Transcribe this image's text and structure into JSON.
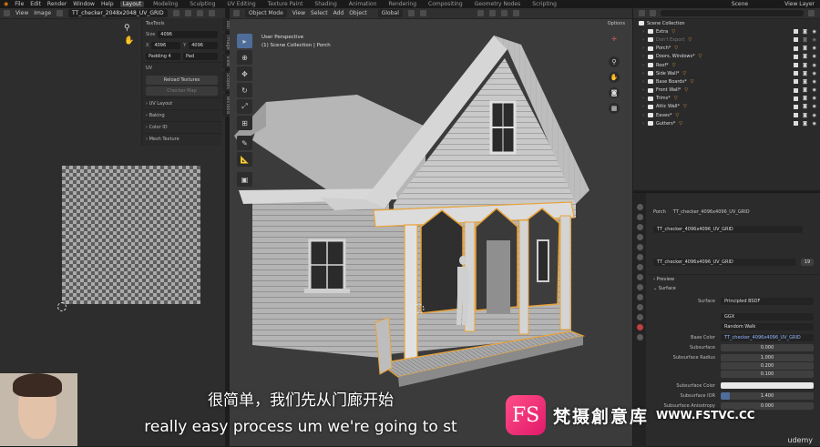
{
  "menu": [
    "File",
    "Edit",
    "Render",
    "Window",
    "Help"
  ],
  "workspaces": [
    "Layout",
    "Modeling",
    "Sculpting",
    "UV Editing",
    "Texture Paint",
    "Shading",
    "Animation",
    "Rendering",
    "Compositing",
    "Geometry Nodes",
    "Scripting"
  ],
  "active_workspace": "Layout",
  "topbar_right": {
    "scene": "Scene",
    "view_layer": "View Layer"
  },
  "uv_editor": {
    "view": "View",
    "image": "Image",
    "image_name": "TT_checker_2048x2048_UV_GRID",
    "npanel": {
      "header": "TexTools",
      "size_label": "Size",
      "size_value": "4096",
      "x_label": "X",
      "x_value": "4096",
      "y_label": "Y",
      "y_value": "4096",
      "padding_label": "Padding",
      "padding_value": "4",
      "pad_right": "Pad",
      "uv_section": "UV",
      "reload_textures": "Reload Textures",
      "checker_map": "Checker Map",
      "sections": [
        "UV Layout",
        "Baking",
        "Color ID",
        "Mesh Texture"
      ]
    },
    "side_tabs": [
      "Tool",
      "Image",
      "View",
      "Scopes",
      "TexTools"
    ]
  },
  "viewport": {
    "mode": "Object Mode",
    "menus": [
      "View",
      "Select",
      "Add",
      "Object"
    ],
    "orientation": "Global",
    "options": "Options",
    "info_line1": "User Perspective",
    "info_line2": "(1) Scene Collection | Porch"
  },
  "outliner": {
    "header": "Scene Collection",
    "items": [
      {
        "name": "Extra",
        "dim": false
      },
      {
        "name": "Don't Export",
        "dim": true
      },
      {
        "name": "Porch*",
        "dim": false
      },
      {
        "name": "Doors, Windows*",
        "dim": false
      },
      {
        "name": "Roof*",
        "dim": false
      },
      {
        "name": "Side Wall*",
        "dim": false
      },
      {
        "name": "Base Boards*",
        "dim": false
      },
      {
        "name": "Front Wall*",
        "dim": false
      },
      {
        "name": "Trims*",
        "dim": false
      },
      {
        "name": "Attic Wall*",
        "dim": false
      },
      {
        "name": "Eaves*",
        "dim": false
      },
      {
        "name": "Gutters*",
        "dim": false
      }
    ]
  },
  "properties": {
    "breadcrumb_object": "Porch",
    "breadcrumb_material": "TT_checker_4096x4096_UV_GRID",
    "slot_name": "TT_checker_4096x4096_UV_GRID",
    "material_name": "TT_checker_4096x4096_UV_GRID",
    "user_count": "19",
    "preview": "Preview",
    "surface_section": "Surface",
    "surface_label": "Surface",
    "surface_value": "Principled BSDF",
    "distribution": "GGX",
    "subsurface_method": "Random Walk",
    "base_color_label": "Base Color",
    "base_color_value": "TT_checker_4096x4096_UV_GRID",
    "subsurface_label": "Subsurface",
    "subsurface_value": "0.000",
    "subsurface_radius_label": "Subsurface Radius",
    "radius": [
      "1.000",
      "0.200",
      "0.100"
    ],
    "subsurface_color_label": "Subsurface Color",
    "subsurface_ior_label": "Subsurface IOR",
    "subsurface_ior_value": "1.400",
    "subsurface_aniso_label": "Subsurface Anisotropy",
    "subsurface_aniso_value": "0.000"
  },
  "subtitles": {
    "chinese": "很简单，我们先从门廊开始",
    "english": "really easy process um we're going to st"
  },
  "watermark": {
    "logo": "FS",
    "chinese": "梵摄創意库",
    "url": "WWW.FSTVC.CC"
  },
  "udemy": "udemy",
  "colors": {
    "accent_blue": "#4f6d9a",
    "selection_orange": "#e8a33a",
    "viewport_bg": "#3b3b3b"
  }
}
